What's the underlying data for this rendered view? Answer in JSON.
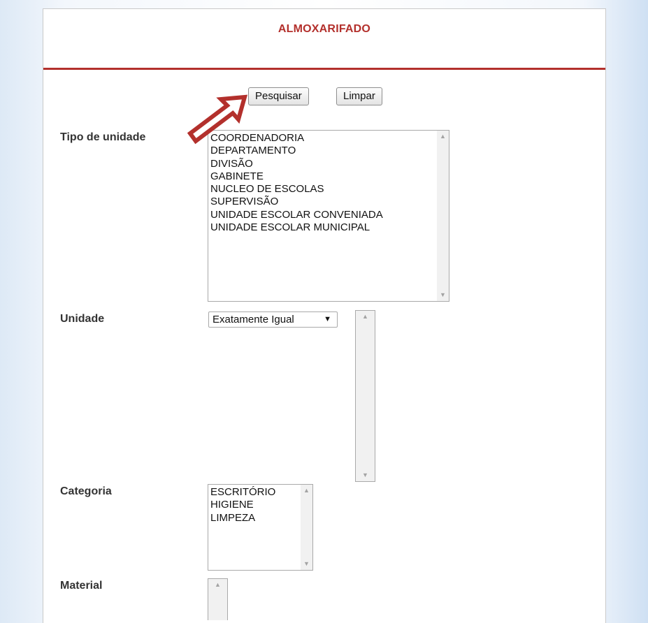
{
  "header": {
    "title": "ALMOXARIFADO"
  },
  "actions": {
    "search_label": "Pesquisar",
    "clear_label": "Limpar"
  },
  "fields": {
    "tipo_unidade": {
      "label": "Tipo de unidade",
      "options": [
        "COORDENADORIA",
        "DEPARTAMENTO",
        "DIVISÃO",
        "GABINETE",
        "NUCLEO DE ESCOLAS",
        "SUPERVISÃO",
        "UNIDADE ESCOLAR CONVENIADA",
        "UNIDADE ESCOLAR MUNICIPAL"
      ]
    },
    "unidade": {
      "label": "Unidade",
      "match_mode": "Exatamente Igual",
      "options": []
    },
    "categoria": {
      "label": "Categoria",
      "options": [
        "ESCRITÓRIO",
        "HIGIENE",
        "LIMPEZA"
      ]
    },
    "material": {
      "label": "Material",
      "options": []
    }
  },
  "annotation": {
    "icon": "arrow-icon",
    "color": "#b3302c"
  },
  "colors": {
    "accent": "#b3302c"
  }
}
